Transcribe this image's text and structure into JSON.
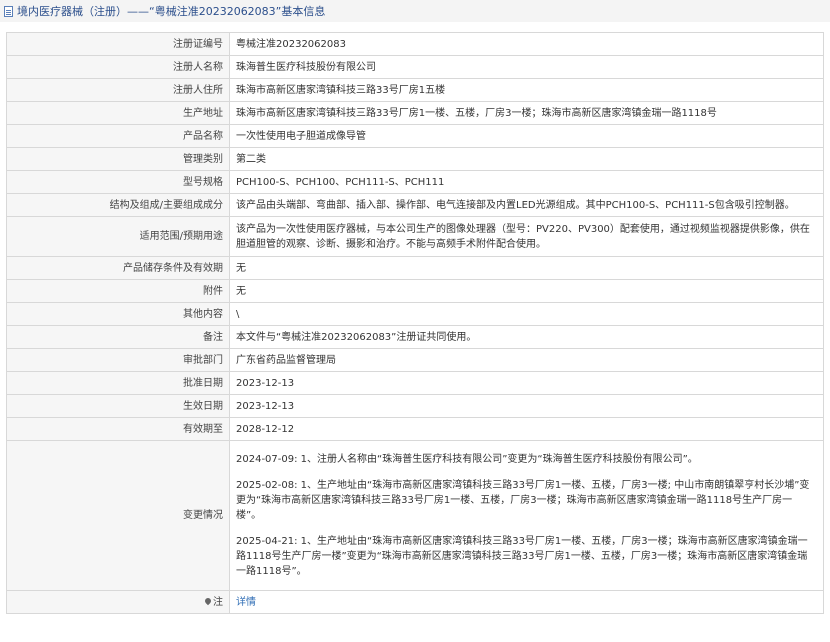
{
  "header": {
    "title": "境内医疗器械（注册）——“粤械注准20232062083”基本信息"
  },
  "rows": [
    {
      "label": "注册证编号",
      "value": "粤械注准20232062083"
    },
    {
      "label": "注册人名称",
      "value": "珠海普生医疗科技股份有限公司"
    },
    {
      "label": "注册人住所",
      "value": "珠海市高新区唐家湾镇科技三路33号厂房1五楼"
    },
    {
      "label": "生产地址",
      "value": "珠海市高新区唐家湾镇科技三路33号厂房1一楼、五楼，厂房3一楼；珠海市高新区唐家湾镇金瑞一路1118号"
    },
    {
      "label": "产品名称",
      "value": "一次性使用电子胆道成像导管"
    },
    {
      "label": "管理类别",
      "value": "第二类"
    },
    {
      "label": "型号规格",
      "value": "PCH100-S、PCH100、PCH111-S、PCH111"
    },
    {
      "label": "结构及组成/主要组成成分",
      "value": "该产品由头端部、弯曲部、插入部、操作部、电气连接部及内置LED光源组成。其中PCH100-S、PCH111-S包含吸引控制器。"
    },
    {
      "label": "适用范围/预期用途",
      "value": "该产品为一次性使用医疗器械，与本公司生产的图像处理器（型号：PV220、PV300）配套使用，通过视频监视器提供影像，供在胆道胆管的观察、诊断、摄影和治疗。不能与高频手术附件配合使用。"
    },
    {
      "label": "产品储存条件及有效期",
      "value": "无"
    },
    {
      "label": "附件",
      "value": "无"
    },
    {
      "label": "其他内容",
      "value": "\\"
    },
    {
      "label": "备注",
      "value": "本文件与“粤械注准20232062083”注册证共同使用。"
    },
    {
      "label": "审批部门",
      "value": "广东省药品监督管理局"
    },
    {
      "label": "批准日期",
      "value": "2023-12-13"
    },
    {
      "label": "生效日期",
      "value": "2023-12-13"
    },
    {
      "label": "有效期至",
      "value": "2028-12-12"
    }
  ],
  "changes": {
    "label": "变更情况",
    "entries": [
      "2024-07-09: 1、注册人名称由“珠海普生医疗科技有限公司”变更为“珠海普生医疗科技股份有限公司”。",
      "2025-02-08: 1、生产地址由“珠海市高新区唐家湾镇科技三路33号厂房1一楼、五楼，厂房3一楼; 中山市南朗镇翠亨村长沙埔”变更为“珠海市高新区唐家湾镇科技三路33号厂房1一楼、五楼，厂房3一楼；珠海市高新区唐家湾镇金瑞一路1118号生产厂房一楼”。",
      "2025-04-21: 1、生产地址由“珠海市高新区唐家湾镇科技三路33号厂房1一楼、五楼，厂房3一楼；珠海市高新区唐家湾镇金瑞一路1118号生产厂房一楼”变更为“珠海市高新区唐家湾镇科技三路33号厂房1一楼、五楼，厂房3一楼；珠海市高新区唐家湾镇金瑞一路1118号”。"
    ]
  },
  "footer": {
    "label": "注",
    "link": "详情"
  }
}
